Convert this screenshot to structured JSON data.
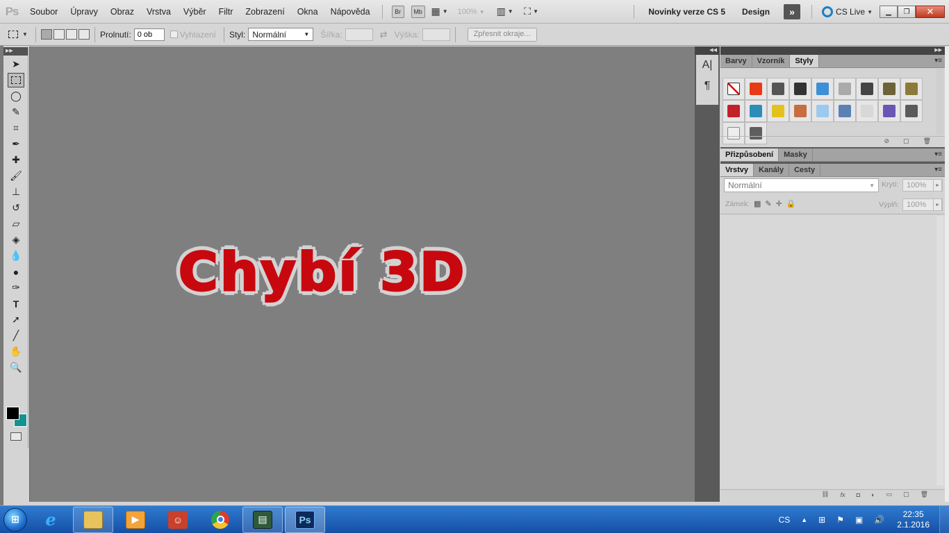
{
  "app": {
    "logo": "Ps"
  },
  "menubar": {
    "items": [
      "Soubor",
      "Úpravy",
      "Obraz",
      "Vrstva",
      "Výběr",
      "Filtr",
      "Zobrazení",
      "Okna",
      "Nápověda"
    ],
    "bridge_label": "Br",
    "minibridge_label": "Mb",
    "zoom": "100%",
    "whats_new": "Novinky verze CS 5",
    "workspace": "Design",
    "cs_live": "CS Live"
  },
  "options": {
    "feather_label": "Prolnutí:",
    "feather_value": "0 ob",
    "antialias_label": "Vyhlazení",
    "style_label": "Styl:",
    "style_value": "Normální",
    "width_label": "Šířka:",
    "height_label": "Výška:",
    "refine_edge": "Zpřesnit okraje..."
  },
  "canvas": {
    "text": "Chybí 3D"
  },
  "panels": {
    "top_tabs": [
      "Barvy",
      "Vzorník",
      "Styly"
    ],
    "top_active": 2,
    "mid_tabs": [
      "Přizpůsobení",
      "Masky"
    ],
    "layer_tabs": [
      "Vrstvy",
      "Kanály",
      "Cesty"
    ],
    "layer_active": 0,
    "blend_mode": "Normální",
    "opacity_label": "Krytí:",
    "opacity_value": "100%",
    "lock_label": "Zámek:",
    "fill_label": "Výplň:",
    "fill_value": "100%",
    "style_swatches": [
      "#ffffff",
      "#e83a16",
      "#555555",
      "#333333",
      "#3d8fd6",
      "#aaaaaa",
      "#444444",
      "#6e6238",
      "#8b7a3a",
      "#c3202a",
      "#2c8db8",
      "#e3c21d",
      "#c66e3d",
      "#9cc9ef",
      "#5b80b4",
      "#d8d8d8",
      "#6b55b5",
      "#5b5b5b",
      "#eeeeee",
      "#5e5e5e"
    ],
    "colors": {
      "fg": "#000000",
      "bg": "#13928f",
      "text_fill": "#c8080f",
      "text_stroke": "#d2d2d2"
    }
  },
  "taskbar": {
    "ps_label": "Ps",
    "language": "CS",
    "time": "22:35",
    "date": "2.1.2016"
  }
}
